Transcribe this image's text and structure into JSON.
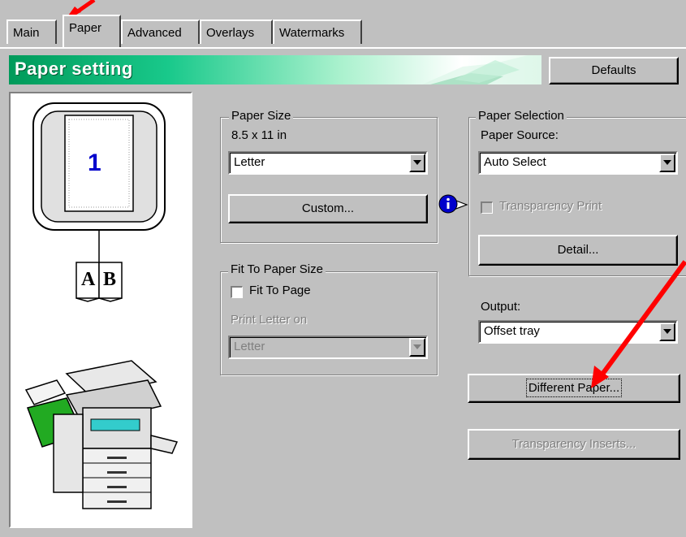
{
  "tabs": [
    {
      "label": "Main"
    },
    {
      "label": "Paper"
    },
    {
      "label": "Advanced"
    },
    {
      "label": "Overlays"
    },
    {
      "label": "Watermarks"
    }
  ],
  "active_tab": "Paper",
  "banner": {
    "title": "Paper setting"
  },
  "defaults_button": {
    "label": "Defaults",
    "mnemonic": "D"
  },
  "preview": {
    "page_number": "1",
    "booklet_left": "A",
    "booklet_right": "B"
  },
  "paper_size": {
    "group_label": "Paper Size",
    "dimensions": "8.5 x 11 in",
    "selected": "Letter",
    "custom_button": "Custom..."
  },
  "fit_to_paper_size": {
    "group_label": "Fit To Paper Size",
    "checkbox_label": "Fit To Page",
    "checked": false,
    "print_on_label": "Print Letter on",
    "print_on_selected": "Letter"
  },
  "paper_selection": {
    "group_label": "Paper Selection",
    "source_label": "Paper Source:",
    "source_selected": "Auto Select",
    "transparency_label": "Transparency Print",
    "transparency_checked": false,
    "detail_button": "Detail..."
  },
  "output": {
    "label": "Output:",
    "selected": "Offset tray"
  },
  "different_paper_button": "Different Paper...",
  "transparency_inserts_button": "Transparency Inserts...",
  "info_icon": "info-icon",
  "colors": {
    "window": "#c0c0c0",
    "banner_green": "#009a5a",
    "annotation_red": "#ff0000",
    "page_number": "#0000cc"
  }
}
